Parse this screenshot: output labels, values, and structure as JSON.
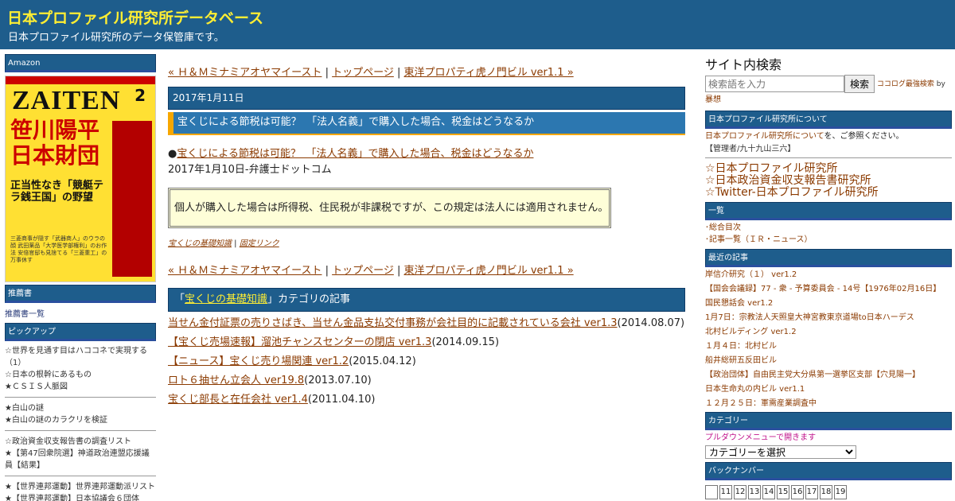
{
  "header": {
    "title": "日本プロファイル研究所データベース",
    "description": "日本プロファイル研究所のデータ保管庫です。"
  },
  "left": {
    "amazon_heading": "Amazon",
    "cover": {
      "logo": "ZAITEN",
      "issue": "2",
      "headline": "笹川陽平 日本財団",
      "subhead": "正当性なき「競艇テラ銭王国」の野望",
      "blurb": "三菱商事が隠す「武器商人」のウラの顔 武田薬品「大学医学部権利」のお作法 安倍官邸も見捨てる「三菱重工」の万事休す"
    },
    "recommended_heading": "推薦書",
    "recommended_link": "推薦書一覧",
    "pickup_heading": "ピックアップ",
    "pickup_groups": [
      [
        "☆世界を見通す目はハココネで実現する（1）",
        "☆日本の根幹にあるもの",
        "★ＣＳＩＳ人脈図"
      ],
      [
        "★白山の謎",
        "★白山の謎のカラクリを検証"
      ],
      [
        "☆政治資金収支報告書の調査リスト",
        "★【第47回衆院選】神道政治連盟応援議員【結果】"
      ],
      [
        "★【世界連邦運動】世界連邦運動派リスト",
        "★【世界連邦運動】日本協議会６団体"
      ]
    ]
  },
  "main": {
    "nav": {
      "prev": "« Ｈ＆Ｍミナミアオヤマイースト",
      "sep1": " | ",
      "top": "トップページ",
      "sep2": " | ",
      "next": "東洋プロパティ虎ノ門ビル ver1.1 »"
    },
    "date": "2017年1月11日",
    "title": "宝くじによる節税は可能？　「法人名義」で購入した場合、税金はどうなるか",
    "source_bullet": "●",
    "source_link": "宝くじによる節税は可能？　「法人名義」で購入した場合、税金はどうなるか",
    "source_meta": "2017年1月10日-弁護士ドットコム",
    "quote": "個人が購入した場合は所得税、住民税が非課税ですが、この規定は法人には適用されません。",
    "meta_category": "宝くじの基礎知識",
    "meta_sep": " | ",
    "meta_permalink": "固定リンク",
    "category_section": {
      "open_quote": "「",
      "name": "宝くじの基礎知識",
      "suffix": "」カテゴリの記事"
    },
    "articles": [
      {
        "title": "当せん金付証票の売りさばき、当せん金品支払交付事務が会社目的に記載されている会社 ver1.3",
        "date": "(2014.08.07)"
      },
      {
        "title": "【宝くじ売場速報】溜池チャンスセンターの閉店 ver1.3",
        "date": "(2014.09.15)"
      },
      {
        "title": "【ニュース】宝くじ売り場関連 ver1.2",
        "date": "(2015.04.12)"
      },
      {
        "title": "ロト６抽せん立会人 ver19.8",
        "date": "(2013.07.10)"
      },
      {
        "title": "宝くじ部長と在任会社 ver1.4",
        "date": "(2011.04.10)"
      }
    ]
  },
  "right": {
    "search_title": "サイト内検索",
    "search_placeholder": "検索語を入力",
    "search_button": "検索",
    "search_powered": "ココログ最強検索",
    "search_by": " by ",
    "search_author": "暴想",
    "about_heading": "日本プロファイル研究所について",
    "about_link": "日本プロファイル研究所について",
    "about_text": "を、ご参照ください。",
    "admin_text": "【管理者/九十九山三六】",
    "star_links": [
      "☆日本プロファイル研究所",
      "☆日本政治資金収支報告書研究所",
      "☆Twitter-日本プロファイル研究所"
    ],
    "list_heading": "一覧",
    "list_items": [
      "･総合目次",
      "･記事一覧（ＩＲ・ニュース）"
    ],
    "recent_heading": "最近の記事",
    "recent_items": [
      "岸信介研究（１） ver1.2",
      "【国会会議録】77 - 衆 - 予算委員会 - 14号【1976年02月16日】",
      "国民懇話会 ver1.2",
      "1月7日：宗教法人天照皇大神宮教東京道場to日本ハーデス",
      "北村ビルディング ver1.2",
      "１月４日：北村ビル",
      "船井総研五反田ビル",
      "【政治団体】自由民主党大分県第一選挙区支部【穴見陽一】",
      "日本生命丸の内ビル ver1.1",
      "１２月２５日：軍需産業調査中"
    ],
    "category_heading": "カテゴリー",
    "category_hint": "プルダウンメニューで開きます",
    "category_select": "カテゴリーを選択",
    "backnumber_heading": "バックナンバー",
    "calendar": [
      "",
      "11",
      "12",
      "13",
      "14",
      "15",
      "16",
      "17",
      "18",
      "19"
    ]
  }
}
